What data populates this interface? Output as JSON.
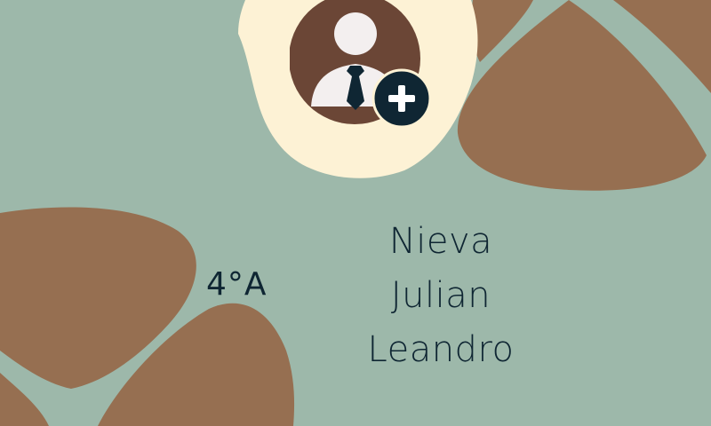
{
  "student": {
    "grade": "4°A",
    "last_name": "Nieva",
    "first_name": "Julian",
    "middle_name": "Leandro"
  },
  "icons": {
    "avatar": "user-with-tie-icon",
    "add": "plus-circle-icon"
  },
  "colors": {
    "background": "#9db8aa",
    "blob_brown": "#966f51",
    "blob_cream": "#fdf2d5",
    "avatar_circle": "#6b4636",
    "avatar_figure": "#f3efef",
    "plus_badge": "#0f2633",
    "text": "#0f2633"
  }
}
